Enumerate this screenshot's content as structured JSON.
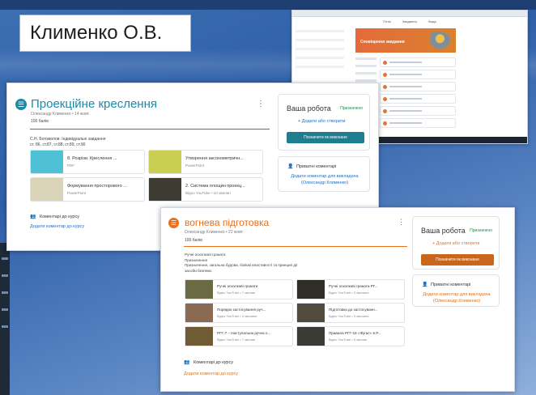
{
  "author": "Клименко О.В.",
  "mini_screenshot": {
    "tabs": [
      "Потік",
      "Завдання",
      "Люди"
    ],
    "banner_title": "Сповіщення завдання"
  },
  "card1": {
    "icon": "assignment-icon",
    "title": "Проекційне креслення",
    "meta": "Олександр Клименко • 14 жовт.",
    "points": "100 балів",
    "description_line1": "С.Н. Богомолов: Індивідуальні завдання",
    "description_line2": "ст. 86, ст.87, ст.88, ст.89, ст.90",
    "accent": "#1e88a8",
    "attachments": [
      {
        "title": "8. Розрізи. Креслення ...",
        "sub": "PDF",
        "thumb": "#4fc1d6"
      },
      {
        "title": "Утворення аксонометричн...",
        "sub": "PowerPoint",
        "thumb": "#c9cf52"
      },
      {
        "title": "Формування просторового ...",
        "sub": "PowerPoint",
        "thumb": "#d9d3b8"
      },
      {
        "title": "2. Система площин проекц...",
        "sub": "Відео YouTube • 10 хвилин",
        "thumb": "#3e3b32"
      }
    ],
    "work": {
      "title": "Ваша робота",
      "status": "Призначено",
      "add_label": "+  Додати або створити",
      "button": "Позначити як виконане",
      "button_color": "#1e7d8f"
    },
    "private": {
      "title": "Приватні коментарі",
      "link": "Додати коментар для викладача (Олександр Клименко)",
      "link_color": "#1e6fc2"
    },
    "class_comments": "Коментарі до курсу",
    "class_comment_link": "Додати коментар до курсу",
    "class_comment_link_color": "#1e6fc2"
  },
  "card2": {
    "icon": "assignment-icon",
    "title": "вогнева підготовка",
    "meta": "Олександр Клименко • 22 жовт.",
    "points": "100 балів",
    "description_line1": "Ручні осколкові гранати",
    "description_line2": "Призначення",
    "description_line3": "Призначення, загальна будова, бойові властивості та принцип дії",
    "description_line4": "засоби безпеки.",
    "accent": "#e8711e",
    "videos": [
      {
        "title": "Ручні осколкові гранати",
        "sub": "Відео YouTube • 7 хвилин",
        "thumb": "#6c6a44"
      },
      {
        "title": "Ручні осколкові гранати РГ...",
        "sub": "Відео YouTube • 3 хвилини",
        "thumb": "#2f2d28"
      },
      {
        "title": "Порядок застосування руч...",
        "sub": "Відео YouTube • 4 хвилини",
        "thumb": "#8a6a52"
      },
      {
        "title": "Підготовка до застосуванн...",
        "sub": "Відео YouTube • 3 хвилини",
        "thumb": "#524a3c"
      },
      {
        "title": "РГГ-7 – Наступальна ручна о...",
        "sub": "Відео YouTube • 7 хвилин",
        "thumb": "#6f5b34"
      },
      {
        "title": "Правила РГГ-18 «Фугас» в Р...",
        "sub": "Відео YouTube • 5 хвилин",
        "thumb": "#3b3a35"
      }
    ],
    "work": {
      "title": "Ваша робота",
      "status": "Призначено",
      "add_label": "+  Додати або створити",
      "button": "Позначити як виконане",
      "button_color": "#c9661c"
    },
    "private": {
      "title": "Приватні коментарі",
      "link": "Додати коментар для викладача (Олександр Клименко)",
      "link_color": "#d9731e"
    },
    "class_comments": "Коментарі до курсу",
    "class_comment_link": "Додати коментар до курсу",
    "class_comment_link_color": "#d9731e"
  }
}
